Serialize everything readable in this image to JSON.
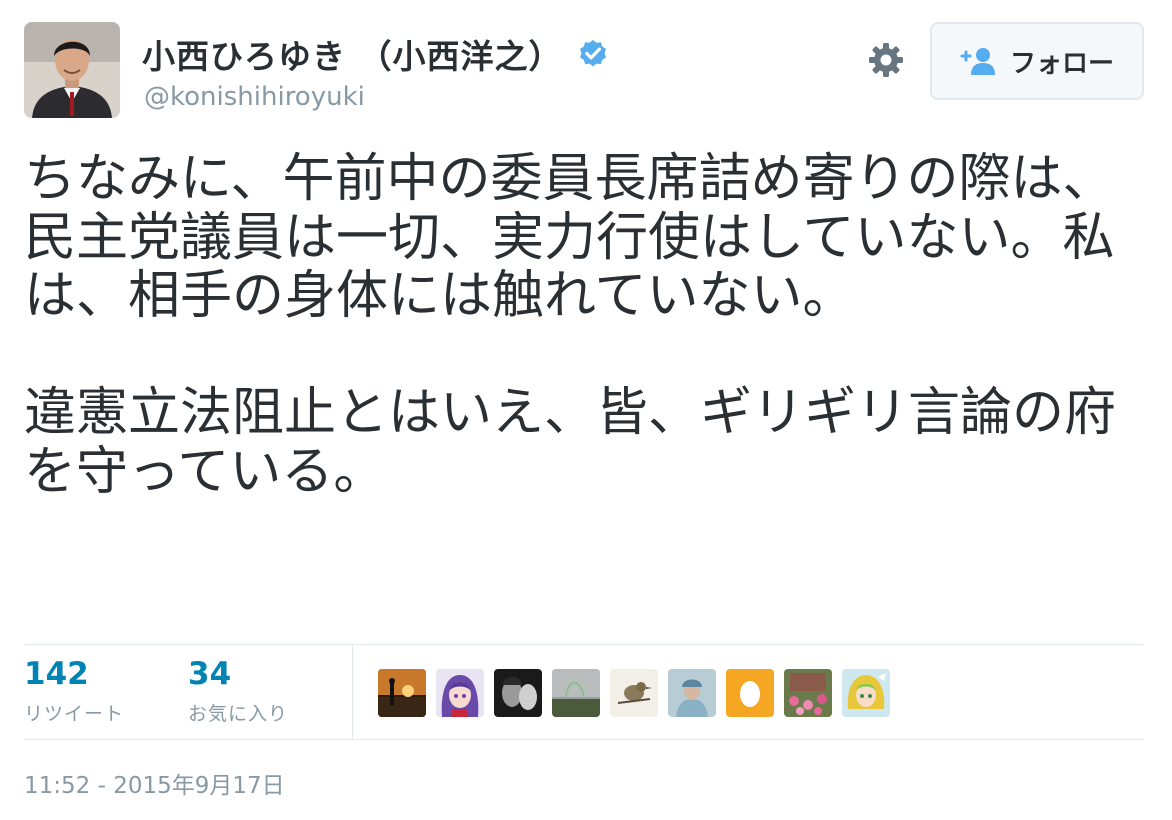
{
  "user": {
    "display_name": "小西ひろゆき （小西洋之）",
    "handle": "@konishihiroyuki",
    "verified": true,
    "avatar_icon": "profile-photo"
  },
  "header": {
    "gear_icon": "gear-icon",
    "follow_icon": "add-user-icon",
    "follow_label": "フォロー"
  },
  "tweet": {
    "text": "ちなみに、午前中の委員長席詰め寄りの際は、民主党議員は一切、実力行使はしていない。私は、相手の身体には触れていない。\n\n違憲立法阻止とはいえ、皆、ギリギリ言論の府を守っている。"
  },
  "stats": {
    "retweets": {
      "count": "142",
      "label": "リツイート"
    },
    "likes": {
      "count": "34",
      "label": "お気に入り"
    }
  },
  "likers": [
    {
      "icon": "sunset-surfer"
    },
    {
      "icon": "anime-purple-hair"
    },
    {
      "icon": "monochrome-portrait"
    },
    {
      "icon": "rainbow-landscape"
    },
    {
      "icon": "bird-sketch"
    },
    {
      "icon": "person-in-cap"
    },
    {
      "icon": "default-egg"
    },
    {
      "icon": "flower-garden"
    },
    {
      "icon": "anime-green-hair"
    }
  ],
  "timestamp": "11:52 - 2015年9月17日",
  "colors": {
    "text": "#292f33",
    "muted": "#8899a6",
    "link_count": "#0084b4",
    "verified": "#55acee",
    "border": "#e1e8ed",
    "egg": "#f5a623"
  }
}
